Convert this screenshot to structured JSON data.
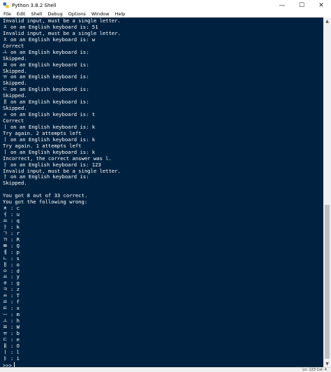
{
  "window": {
    "title": "Python 3.8.2 Shell",
    "minimize": "—",
    "maximize": "☐",
    "close": "✕"
  },
  "menu": [
    "File",
    "Edit",
    "Shell",
    "Debug",
    "Options",
    "Window",
    "Help"
  ],
  "console": {
    "lines": [
      "Invalid input, must be a single letter.",
      "ㅈ on an English keyboard is: 51",
      "Invalid input, must be a single letter.",
      "ㅈ on an English keyboard is: w",
      "Correct",
      "ㅗ on an English keyboard is:",
      "Skipped.",
      "ㅉ on an English keyboard is:",
      "Skipped.",
      "ㅠ on an English keyboard is:",
      "Skipped.",
      "ㄷ on an English keyboard is:",
      "Skipped.",
      "ㅐ on an English keyboard is:",
      "Skipped.",
      "ㅅ on an English keyboard is: t",
      "Correct",
      "ㅣ on an English keyboard is: k",
      "Try again. 2 attempts left",
      "ㅣ on an English keyboard is: k",
      "Try again. 1 attempts left",
      "ㅣ on an English keyboard is: k",
      "Incorrect, the correct answer was l.",
      "ㅏ on an English keyboard is: 123",
      "Invalid input, must be a single letter.",
      "ㅏ on an English keyboard is:",
      "Skipped.",
      "",
      "You got 8 out of 33 correct.",
      "You got the following wrong:",
      "ㅊ : c",
      "ㅕ : u",
      "ㅛ : q",
      "ㅏ : k",
      "ㄱ : r",
      "ㄲ : R",
      "ㅃ : Q",
      "ㅔ : p",
      "ㄴ : s",
      "ㅐ : o",
      "ㅇ : d",
      "ㅛ : y",
      "ㅎ : g",
      "ㅋ : z",
      "ㅆ : T",
      "ㄹ : f",
      "ㅌ : x",
      "ㅡ : m",
      "ㅗ : h",
      "ㅉ : W",
      "ㅠ : b",
      "ㄷ : e",
      "ㅒ : O",
      "ㅣ : l",
      "ㅑ : i"
    ],
    "prompt": ">>>"
  },
  "status": {
    "position": "Ln: 123  Col: 4"
  }
}
